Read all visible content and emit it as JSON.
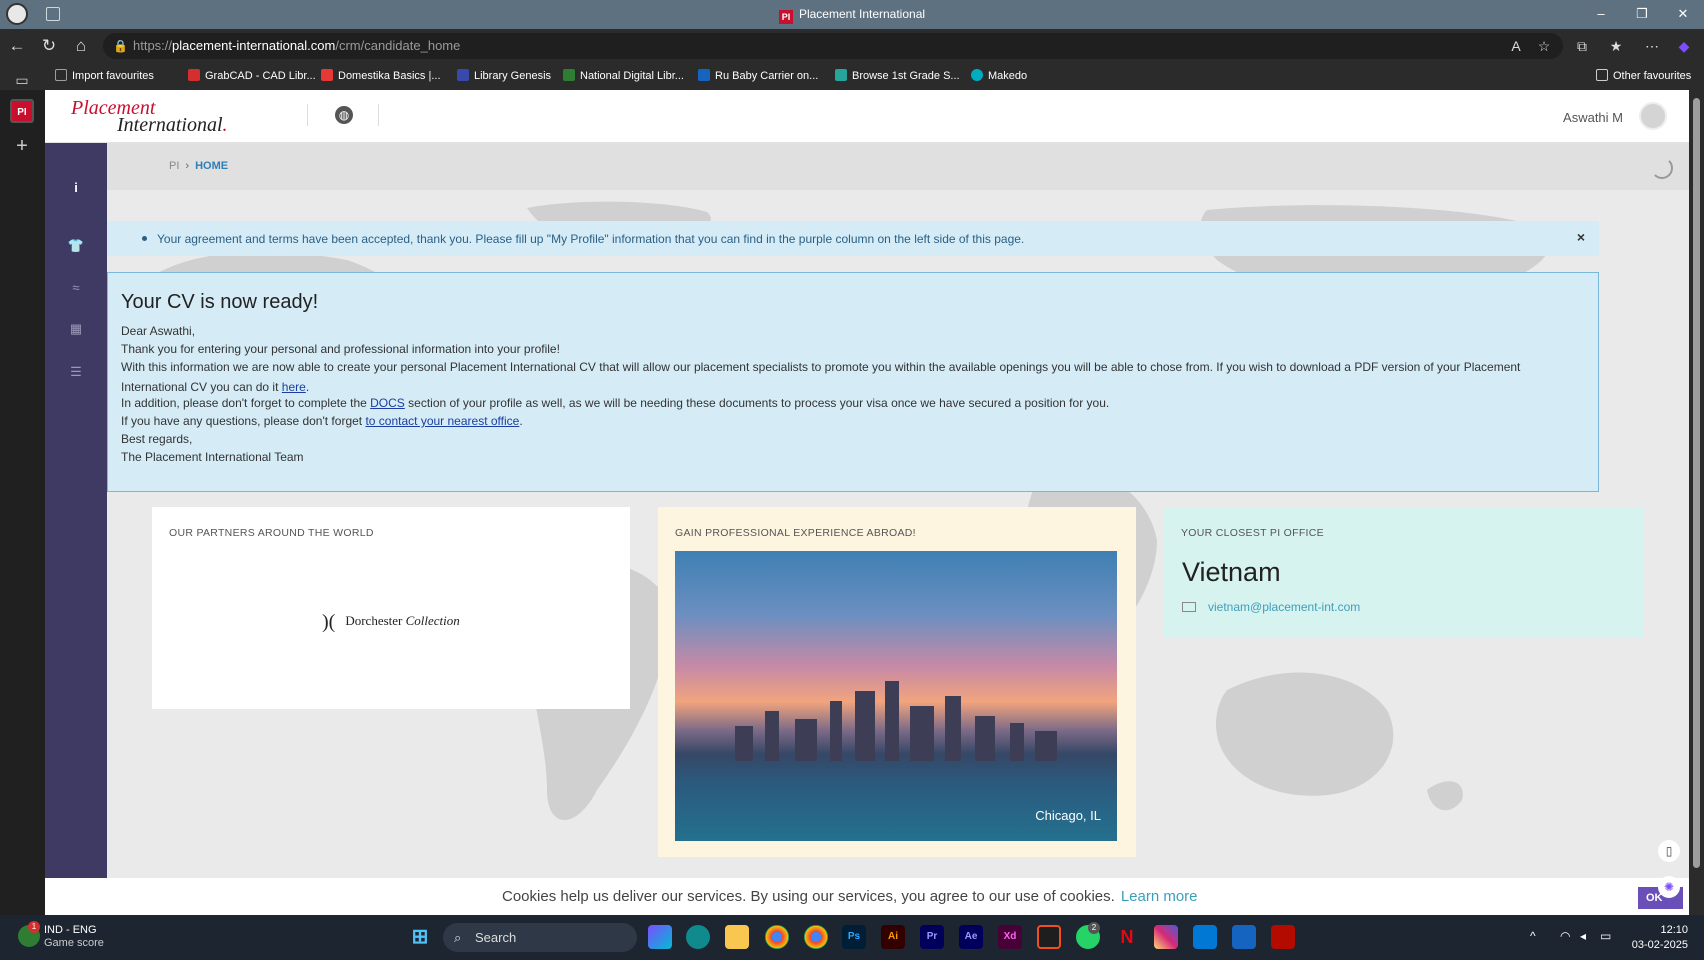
{
  "browser": {
    "window_title": "Placement International",
    "url_prefix": "https://",
    "url_domain": "placement-international.com",
    "url_path": "/crm/candidate_home",
    "bookmarks": [
      {
        "label": "Import favourites",
        "color": "#9e9e9e"
      },
      {
        "label": "GrabCAD - CAD Libr...",
        "color": "#d32f2f"
      },
      {
        "label": "Domestika Basics |...",
        "color": "#e53935"
      },
      {
        "label": "Library Genesis",
        "color": "#3949ab"
      },
      {
        "label": "National Digital Libr...",
        "color": "#2e7d32"
      },
      {
        "label": "Ru Baby Carrier on...",
        "color": "#1565c0"
      },
      {
        "label": "Browse 1st Grade S...",
        "color": "#26a69a"
      },
      {
        "label": "Makedo",
        "color": "#00acc1"
      }
    ],
    "other_favourites": "Other favourites",
    "pi_badge": "PI"
  },
  "header": {
    "logo_line1": "Placement",
    "logo_line2": "International",
    "logo_dot": ".",
    "user_name": "Aswathi M"
  },
  "breadcrumb": {
    "root": "PI",
    "separator": "›",
    "current": "HOME"
  },
  "alert": {
    "message": "Your agreement and terms have been accepted, thank you. Please fill up \"My Profile\" information that you can find in the purple column on the left side of this page.",
    "close": "×"
  },
  "cv": {
    "title": "Your CV is now ready!",
    "greeting": "Dear Aswathi,",
    "line1": "Thank you for entering your personal and professional information into your profile!",
    "line2": "With this information we are now able to create your personal Placement International CV that will allow our placement specialists to promote you within the available openings you will be able to chose from. If you wish to download a PDF version of your Placement International CV you can do it",
    "here_link": "here",
    "line3_pre": "In addition, please don't forget to complete the",
    "docs_link": "DOCS",
    "line3_post": "section of your profile as well, as we will be needing these documents to process your visa once we have secured a position for you.",
    "line4_pre": "If you have any questions, please don't forget",
    "contact_link": "to contact your nearest office",
    "regards": "Best regards,",
    "signature": "The Placement International Team"
  },
  "partners": {
    "title": "OUR PARTNERS AROUND THE WORLD",
    "logo_mark": ")(",
    "logo_word1": "Dorchester",
    "logo_word2": "Collection"
  },
  "experience": {
    "title": "GAIN PROFESSIONAL EXPERIENCE ABROAD!",
    "photo_caption": "Chicago, IL"
  },
  "office": {
    "title": "YOUR CLOSEST PI OFFICE",
    "country": "Vietnam",
    "email": "vietnam@placement-int.com"
  },
  "cookie": {
    "text": "Cookies help us deliver our services. By using our services, you agree to our use of cookies.",
    "learn_more": "Learn more",
    "ok": "OK"
  },
  "taskbar": {
    "lang": "IND - ENG",
    "game": "Game score",
    "search": "Search",
    "time": "12:10",
    "date": "03-02-2025",
    "badge_start": "1",
    "badge_whatsapp": "2",
    "apps": [
      {
        "label": "Ps",
        "bg": "#001e36",
        "fg": "#31a8ff"
      },
      {
        "label": "Ai",
        "bg": "#330000",
        "fg": "#ff9a00"
      },
      {
        "label": "Pr",
        "bg": "#00005b",
        "fg": "#9999ff"
      },
      {
        "label": "Ae",
        "bg": "#00005b",
        "fg": "#9999ff"
      },
      {
        "label": "Xd",
        "bg": "#470137",
        "fg": "#ff61f6"
      }
    ]
  }
}
